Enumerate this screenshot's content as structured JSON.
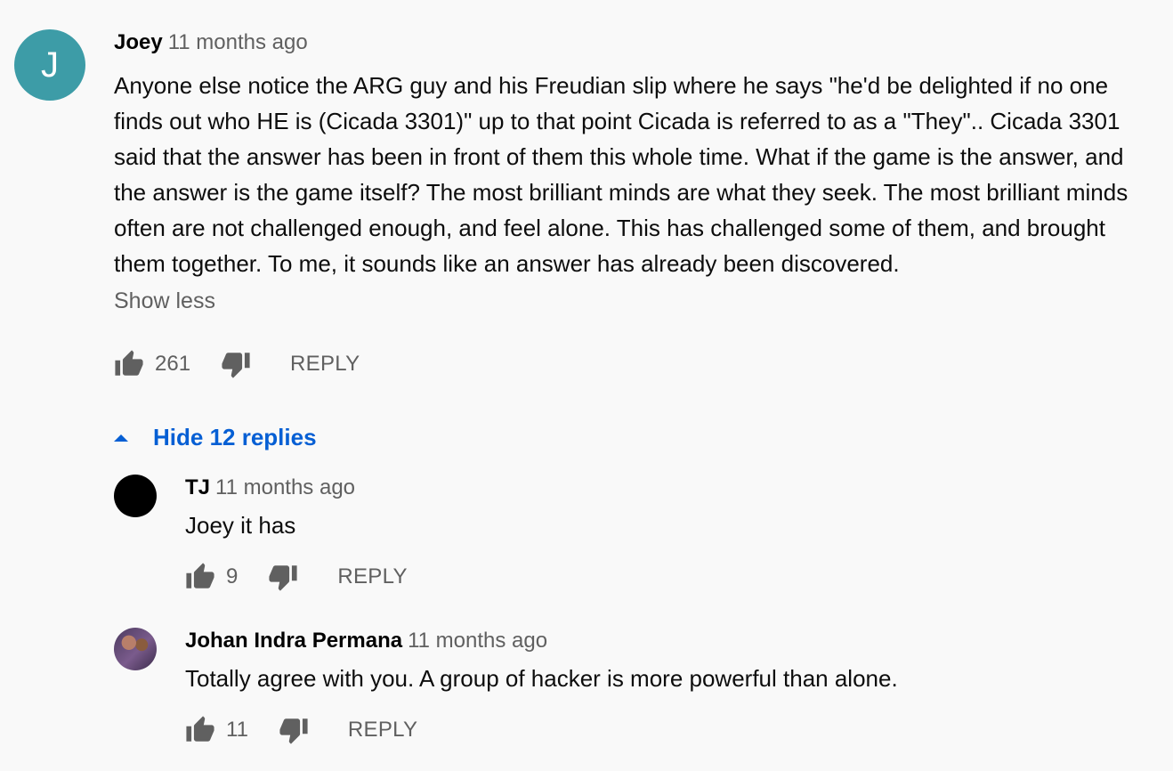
{
  "top_comment": {
    "avatar_letter": "J",
    "avatar_color": "#3d9ca7",
    "author": "Joey",
    "time": "11 months ago",
    "text": "Anyone else notice the ARG guy and his Freudian slip where he says \"he'd be delighted if no one finds out who HE is (Cicada 3301)\" up to that point Cicada is referred to as a \"They\".. Cicada 3301 said that the answer has been in front of them this whole time. What if the game is the answer, and the answer is the game itself?  The most brilliant minds are what they seek. The most brilliant minds often are not challenged enough, and feel alone. This has challenged some of them, and brought them together. To me, it sounds like an answer has already been discovered.",
    "show_less": "Show less",
    "likes": "261",
    "reply_label": "REPLY"
  },
  "replies_toggle": {
    "label": "Hide 12 replies",
    "color": "#065fd4"
  },
  "replies": [
    {
      "author": "TJ",
      "time": "11 months ago",
      "text": "Joey it has",
      "likes": "9",
      "reply_label": "REPLY",
      "avatar_color": "#000000"
    },
    {
      "author": "Johan Indra Permana",
      "time": "11 months ago",
      "text": "Totally agree with you. A group of hacker is more powerful than alone.",
      "likes": "11",
      "reply_label": "REPLY",
      "avatar_color": "#6b4a78"
    }
  ]
}
